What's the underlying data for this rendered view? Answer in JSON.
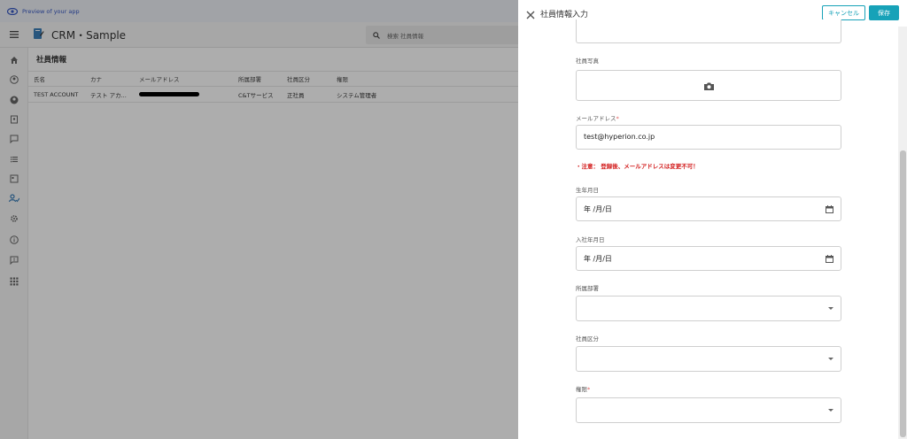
{
  "preview": {
    "label": "Preview of your app"
  },
  "app": {
    "title": "CRM・Sample",
    "search_placeholder": "検索 社員情報"
  },
  "page": {
    "title": "社員情報"
  },
  "table": {
    "headers": [
      "氏名",
      "カナ",
      "メールアドレス",
      "所属部署",
      "社員区分",
      "権限"
    ],
    "rows": [
      [
        "TEST ACCOUNT",
        "テスト アカ...",
        "",
        "C&Tサービス",
        "正社員",
        "システム管理者"
      ]
    ]
  },
  "panel": {
    "title": "社員情報入力",
    "cancel": "キャンセル",
    "save": "保存",
    "photo_label": "社員写真",
    "email_label": "メールアドレス",
    "email_value": "test@hyperion.co.jp",
    "warning": "・注意： 登録後、メールアドレスは変更不可！",
    "birth_label": "生年月日",
    "birth_value": "年 /月/日",
    "join_label": "入社年月日",
    "join_value": "年 /月/日",
    "dept_label": "所属部署",
    "type_label": "社員区分",
    "role_label": "権限",
    "required_mark": "*"
  },
  "colors": {
    "accent": "#17a2b8",
    "warning": "#d32020",
    "link": "#3557c4"
  }
}
